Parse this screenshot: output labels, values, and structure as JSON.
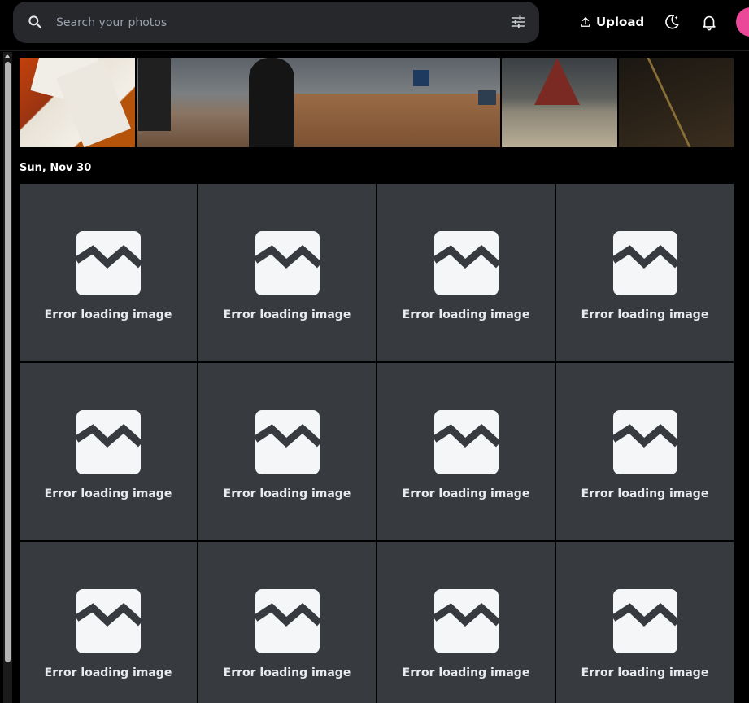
{
  "header": {
    "search_placeholder": "Search your photos",
    "upload_label": "Upload",
    "avatar_color": "#ec4899"
  },
  "timeline": {
    "date_label": "Sun, Nov 30",
    "tiles": [
      {
        "message": "Error loading image"
      },
      {
        "message": "Error loading image"
      },
      {
        "message": "Error loading image"
      },
      {
        "message": "Error loading image"
      },
      {
        "message": "Error loading image"
      },
      {
        "message": "Error loading image"
      },
      {
        "message": "Error loading image"
      },
      {
        "message": "Error loading image"
      },
      {
        "message": "Error loading image"
      },
      {
        "message": "Error loading image"
      },
      {
        "message": "Error loading image"
      },
      {
        "message": "Error loading image"
      }
    ]
  },
  "icons": {
    "search": "search-icon",
    "filter": "tune-icon",
    "upload": "upload-icon",
    "theme": "theme-toggle-icon",
    "notifications": "bell-icon",
    "tile": "broken-image-icon"
  },
  "colors": {
    "background": "#000000",
    "tile_background": "#373a3f",
    "search_background": "#26282b"
  }
}
